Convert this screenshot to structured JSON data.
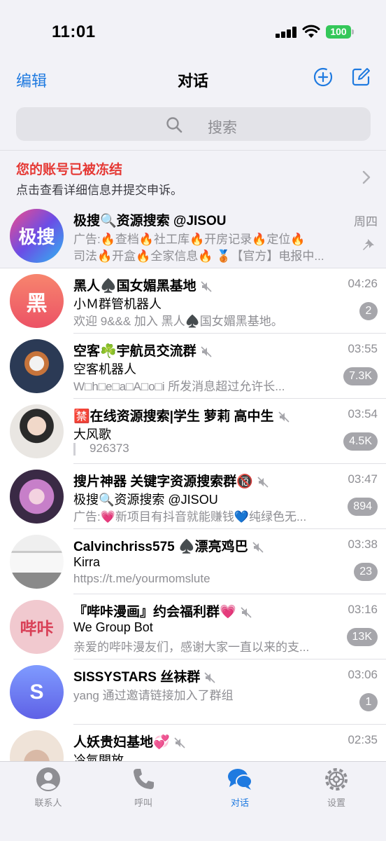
{
  "status": {
    "time": "11:01",
    "battery": "100"
  },
  "nav": {
    "edit": "编辑",
    "title": "对话"
  },
  "search": {
    "placeholder": "搜索"
  },
  "notice": {
    "title": "您的账号已被冻结",
    "subtitle": "点击查看详细信息并提交申诉。"
  },
  "chats": [
    {
      "title": "极搜🔍资源搜索 @JISOU",
      "time": "周四",
      "line1": "广告:🔥查档🔥社工库🔥开房记录🔥定位🔥",
      "line2": "司法🔥开盒🔥全家信息🔥 🥉【官方】电报中...",
      "pinned": true,
      "avatar_color": "#6b4de6",
      "avatar_text": "极搜"
    },
    {
      "title": "黑人♠️国女媚黑基地",
      "time": "04:26",
      "sender": "小Ｍ群管机器人",
      "msg": "欢迎 9&&& 加入 黑人♠️国女媚黑基地。",
      "badge": "2",
      "avatar_color": "#f06a5c",
      "avatar_text": "黑"
    },
    {
      "title": "空客☘️宇航员交流群",
      "time": "03:55",
      "sender": "空客机器人",
      "msg": "W□h□e□a□A□o□i 所发消息超过允许长...",
      "badge": "7.3K",
      "avatar_color": "#2b3a55",
      "avatar_text": ""
    },
    {
      "title": "🈲在线资源搜索|学生 萝莉 高中生",
      "time": "03:54",
      "sender": "大风歌",
      "msg": "926373",
      "badge": "4.5K",
      "avatar_color": "#d9d4cf",
      "avatar_text": ""
    },
    {
      "title": "搜片神器 关键字资源搜索群🔞",
      "time": "03:47",
      "sender": "极搜🔍资源搜索 @JISOU",
      "msg": "广告:💗新项目有抖音就能赚钱💙纯绿色无...",
      "badge": "894",
      "avatar_color": "#8a5a9e",
      "avatar_text": ""
    },
    {
      "title": "Calvinchriss575 ♠️漂亮鸡巴",
      "time": "03:38",
      "sender": "Kirra",
      "msg": "https://t.me/yourmomslute",
      "badge": "23",
      "avatar_color": "#9a9a9a",
      "avatar_text": ""
    },
    {
      "title": "『哔咔漫画』约会福利群💗",
      "time": "03:16",
      "sender": "We Group Bot",
      "msg": "亲爱的哔咔漫友们，感谢大家一直以来的支...",
      "badge": "13K",
      "avatar_color": "#e37a8a",
      "avatar_text": "哔咔"
    },
    {
      "title": "SISSYSTARS 丝袜群",
      "time": "03:06",
      "msg": "yang 通过邀请链接加入了群组",
      "badge": "1",
      "avatar_color": "#6f7ff0",
      "avatar_text": "S"
    },
    {
      "title": "人妖贵妇基地💞",
      "time": "02:35",
      "sender": "冷氣開放",
      "avatar_color": "#e9d9cc",
      "avatar_text": ""
    }
  ],
  "tabs": [
    {
      "label": "联系人",
      "icon": "person-icon"
    },
    {
      "label": "呼叫",
      "icon": "phone-icon"
    },
    {
      "label": "对话",
      "icon": "chat-bubbles-icon"
    },
    {
      "label": "设置",
      "icon": "gear-icon"
    }
  ],
  "colors": {
    "accent": "#1f7ae0",
    "alert": "#e53935",
    "badge": "#a6a6ab",
    "battery": "#34c759"
  }
}
